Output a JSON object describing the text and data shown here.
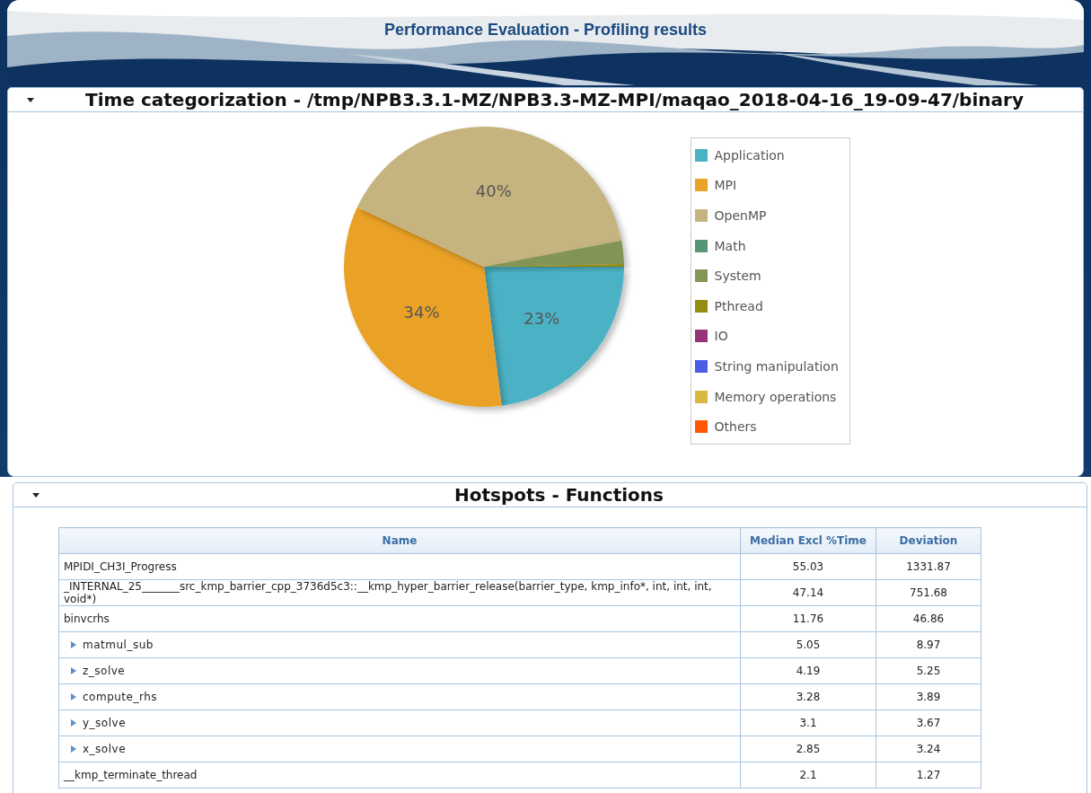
{
  "header": {
    "title": "Performance Evaluation - Profiling results"
  },
  "sections": [
    {
      "title": "Time categorization - /tmp/NPB3.3.1-MZ/NPB3.3-MZ-MPI/maqao_2018-04-16_19-09-47/binary",
      "expanded": true,
      "chart_data": {
        "type": "pie",
        "categories": [
          "Application",
          "MPI",
          "OpenMP",
          "Math",
          "System",
          "Pthread",
          "IO",
          "String manipulation",
          "Memory operations",
          "Others"
        ],
        "series": [
          {
            "values": [
              23,
              34,
              40,
              0,
              2.7,
              0.3,
              0,
              0,
              0,
              0
            ]
          }
        ],
        "colors": [
          "#4bb2c5",
          "#eaa228",
          "#c5b47f",
          "#579575",
          "#839557",
          "#958c12",
          "#953579",
          "#4b5de4",
          "#d8b83f",
          "#ff5800"
        ],
        "legend": "right",
        "value_labels": [
          "23%",
          "34%",
          "40%",
          null,
          null,
          null,
          null,
          null,
          null,
          null
        ]
      }
    },
    {
      "title": "Hotspots - Functions",
      "expanded": true,
      "table": {
        "columns": [
          "Name",
          "Median Excl %Time",
          "Deviation"
        ],
        "rows": [
          {
            "kind": "plain",
            "name": "MPIDI_CH3I_Progress",
            "time": "55.03",
            "deviation": "1331.87"
          },
          {
            "kind": "plain",
            "name": "_INTERNAL_25_______src_kmp_barrier_cpp_3736d5c3::__kmp_hyper_barrier_release(barrier_type, kmp_info*, int, int, int, void*)",
            "time": "47.14",
            "deviation": "751.68"
          },
          {
            "kind": "plain",
            "name": "binvcrhs",
            "time": "11.76",
            "deviation": "46.86"
          },
          {
            "kind": "expandable",
            "name": "matmul_sub",
            "time": "5.05",
            "deviation": "8.97"
          },
          {
            "kind": "expandable",
            "name": "z_solve",
            "time": "4.19",
            "deviation": "5.25"
          },
          {
            "kind": "expandable",
            "name": "compute_rhs",
            "time": "3.28",
            "deviation": "3.89"
          },
          {
            "kind": "expandable",
            "name": "y_solve",
            "time": "3.1",
            "deviation": "3.67"
          },
          {
            "kind": "expandable",
            "name": "x_solve",
            "time": "2.85",
            "deviation": "3.24"
          },
          {
            "kind": "plain",
            "name": "__kmp_terminate_thread",
            "time": "2.1",
            "deviation": "1.27"
          }
        ]
      }
    }
  ]
}
